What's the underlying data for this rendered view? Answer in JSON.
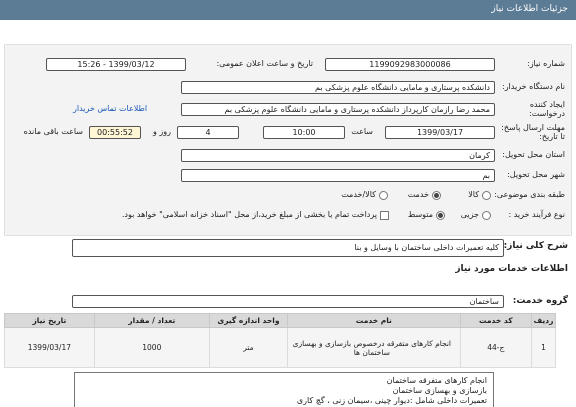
{
  "header": {
    "title": "جزئیات اطلاعات نیاز"
  },
  "form": {
    "need_number": {
      "label": "شماره نیاز:",
      "value": "1199092983000086"
    },
    "announce_date": {
      "label": "تاریخ و ساعت اعلان عمومی:",
      "value": "1399/03/12 - 15:26"
    },
    "buyer": {
      "label": "نام دستگاه خریدار:",
      "value": "دانشکده پرستاری و مامایی دانشگاه علوم پزشکی بم"
    },
    "creator": {
      "label": "ایجاد کننده درخواست:",
      "value": "محمد رضا  رازمان  کارپرداز دانشکده پرستاری و مامایی دانشگاه علوم پزشکی بم",
      "contact_link": "اطلاعات تماس خریدار"
    },
    "deadline": {
      "label": "مهلت ارسال پاسخ: تا تاریخ:",
      "date": "1399/03/17",
      "time_label": "ساعت",
      "time": "10:00",
      "days": "4",
      "days_label": "روز و",
      "remaining": "00:55:52",
      "remaining_label": "ساعت باقی مانده"
    },
    "province": {
      "label": "استان محل تحویل:",
      "value": "کرمان"
    },
    "city": {
      "label": "شهر محل تحویل:",
      "value": "بم"
    },
    "category": {
      "label": "طبقه بندی موضوعی:",
      "options": [
        "کالا",
        "خدمت",
        "کالا/خدمت"
      ],
      "selected": "خدمت"
    },
    "process": {
      "label": "نوع فرآیند خرید :",
      "options": [
        "جزیی",
        "متوسط"
      ],
      "selected": "متوسط",
      "note": "پرداخت تمام یا بخشی از مبلغ خرید،از محل \"اسناد خزانه اسلامی\" خواهد بود."
    }
  },
  "summary": {
    "label": "شرح کلی نیاز:",
    "value": "کلیه تعمیرات داخلی ساختمان با وسایل و بنا"
  },
  "services_heading": "اطلاعات خدمات مورد نیاز",
  "service_group": {
    "label": "گروه خدمت:",
    "value": "ساختمان"
  },
  "table": {
    "headers": [
      "ردیف",
      "کد خدمت",
      "نام خدمت",
      "واحد اندازه گیری",
      "تعداد / مقدار",
      "تاریخ نیاز"
    ],
    "rows": [
      [
        "1",
        "ج-44",
        "انجام کارهای متفرقه درخصوص بازسازی و بهسازی ساختمان ها",
        "متر",
        "1000",
        "1399/03/17"
      ]
    ]
  },
  "notes": [
    "انجام کارهای متفرقه ساختمان",
    "بازسازی و بهسازی ساختمان",
    "تعمیرات داخلی  شامل :دیوار چینی ،سیمان زنی ، گچ کاری"
  ]
}
